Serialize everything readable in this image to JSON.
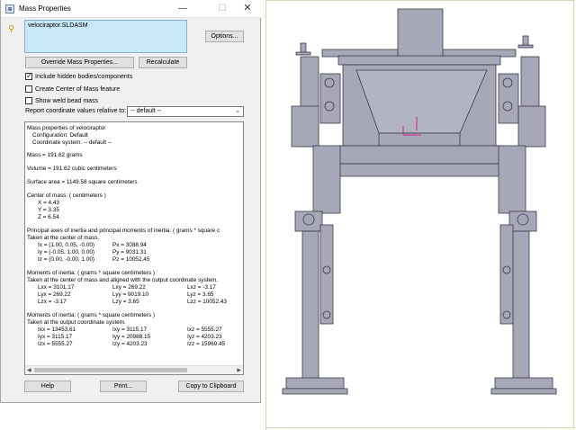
{
  "window": {
    "title": "Mass Properties",
    "minimize": "—",
    "maximize": "☐",
    "close": "✕"
  },
  "selection": {
    "file": "velociraptor.SLDASM"
  },
  "buttons": {
    "options": "Options...",
    "override": "Override Mass Properties...",
    "recalculate": "Recalculate",
    "help": "Help",
    "print": "Print...",
    "copy": "Copy to Clipboard"
  },
  "checkboxes": {
    "hidden": {
      "label": "Include hidden bodies/components",
      "checked": true
    },
    "com": {
      "label": "Create Center of Mass feature",
      "checked": false
    },
    "weld": {
      "label": "Show weld bead mass",
      "checked": false
    }
  },
  "report": {
    "label": "Report coordinate values relative to:",
    "selected": "-- default --"
  },
  "results": {
    "header": "Mass properties of velociraptor",
    "configuration": "Configuration: Default",
    "coordinate_system": "Coordinate system: -- default --",
    "mass": "Mass = 191.62 grams",
    "volume": "Volume = 191.62 cubic centimeters",
    "surface_area": "Surface area = 1149.58  square centimeters",
    "com_header": "Center of mass: ( centimeters )",
    "com_x": "X = 4.43",
    "com_y": "Y = 3.35",
    "com_z": "Z = 6.54",
    "principal_header": "Principal axes of inertia and principal moments of inertia: ( grams *  square c",
    "principal_sub": "Taken at the center of mass.",
    "ix": "Ix = (1.00, 0.05, -0.00)",
    "px": "Px = 3088.94",
    "iy": "Iy = (-0.05, 1.00, 0.00)",
    "py": "Py = 9031.31",
    "iz": "Iz = (0.00, -0.00, 1.00)",
    "pz": "Pz = 10052.45",
    "moi1_header": "Moments of inertia: ( grams *  square centimeters )",
    "moi1_sub": "Taken at the center of mass and aligned with the output coordinate system.",
    "m1": [
      [
        "Lxx = 3101.17",
        "Lxy = 269.22",
        "Lxz = -3.17"
      ],
      [
        "Lyx = 269.22",
        "Lyy = 9019.10",
        "Lyz = 3.65"
      ],
      [
        "Lzx = -3.17",
        "Lzy = 3.65",
        "Lzz = 10052.43"
      ]
    ],
    "moi2_header": "Moments of inertia: ( grams *  square centimeters )",
    "moi2_sub": "Taken at the output coordinate system.",
    "m2": [
      [
        "Ixx = 13453.61",
        "Ixy = 3115.17",
        "Ixz = 5555.27"
      ],
      [
        "Iyx = 3115.17",
        "Iyy = 20988.15",
        "Iyz = 4203.23"
      ],
      [
        "Izx = 5555.27",
        "Izy = 4203.23",
        "Izz = 15969.45"
      ]
    ]
  },
  "colors": {
    "selection_bg": "#c8e8f8",
    "cad_fill": "#a6a8b8",
    "cad_stroke": "#3a3a4a"
  },
  "icons": {
    "pin": "pin-icon",
    "app": "mass-properties-icon",
    "dropdown": "chevron-down-icon"
  }
}
